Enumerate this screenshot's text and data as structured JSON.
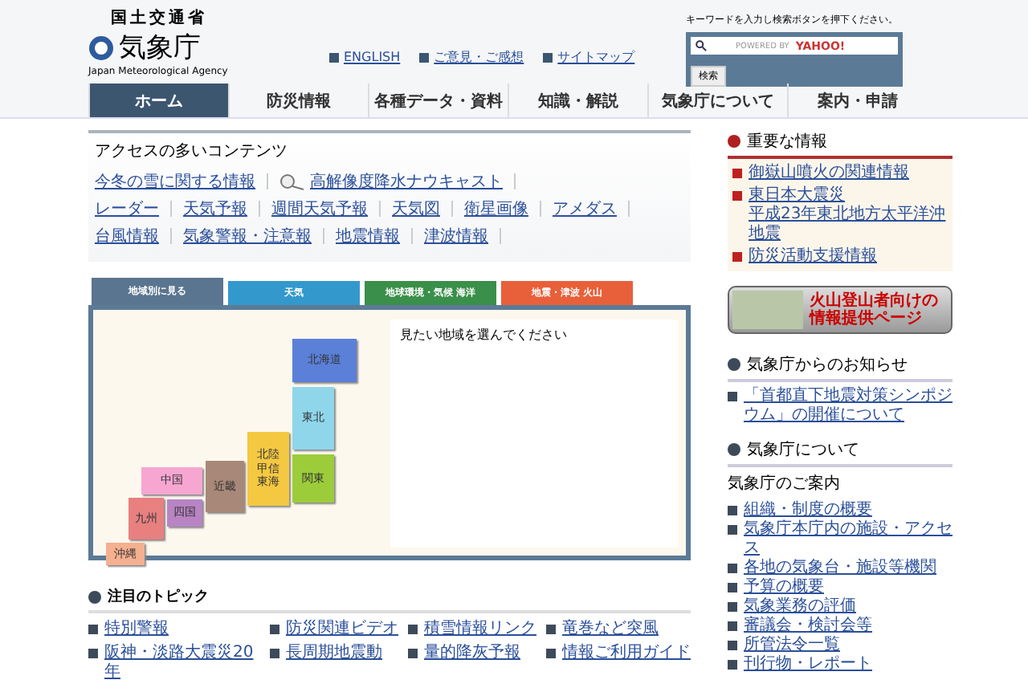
{
  "header": {
    "ministry": "国土交通省",
    "agency": "気象庁",
    "agency_en": "Japan Meteorological Agency",
    "links": [
      "ENGLISH",
      "ご意見・ご感想",
      "サイトマップ"
    ],
    "search": {
      "hint": "キーワードを入力し検索ボタンを押下ください。",
      "powered": "POWERED BY",
      "brand": "YAHOO!",
      "button": "検索"
    }
  },
  "nav": [
    {
      "label": "ホーム",
      "selected": true
    },
    {
      "label": "防災情報",
      "selected": false
    },
    {
      "label": "各種データ・資料",
      "selected": false
    },
    {
      "label": "知識・解説",
      "selected": false
    },
    {
      "label": "気象庁について",
      "selected": false
    },
    {
      "label": "案内・申請",
      "selected": false
    }
  ],
  "popular": {
    "title": "アクセスの多いコンテンツ",
    "rows": [
      {
        "links": [
          {
            "label": "今冬の雪に関する情報",
            "kind": "text"
          },
          {
            "label": "高解像度降水ナウキャスト",
            "kind": "icon"
          }
        ]
      },
      {
        "links": [
          {
            "label": "レーダー",
            "kind": "text"
          },
          {
            "label": "天気予報",
            "kind": "text"
          },
          {
            "label": "週間天気予報",
            "kind": "text"
          },
          {
            "label": "天気図",
            "kind": "text"
          },
          {
            "label": "衛星画像",
            "kind": "text"
          },
          {
            "label": "アメダス",
            "kind": "text"
          }
        ]
      },
      {
        "links": [
          {
            "label": "台風情報",
            "kind": "text"
          },
          {
            "label": "気象警報・注意報",
            "kind": "text"
          },
          {
            "label": "地震情報",
            "kind": "text"
          },
          {
            "label": "津波情報",
            "kind": "text"
          }
        ]
      }
    ]
  },
  "tabs": [
    {
      "label": "地域別に見る",
      "selected": true,
      "color": "#5a7590"
    },
    {
      "label": "天気",
      "selected": false,
      "color": "#3399cc"
    },
    {
      "label": "地球環境・気候 海洋",
      "selected": false,
      "color": "#3a8f4a"
    },
    {
      "label": "地震・津波 火山",
      "selected": false,
      "color": "#e8603a"
    }
  ],
  "regions": {
    "message": "見たい地域を選んでください",
    "areas": [
      {
        "lines": [
          "北海道"
        ],
        "color": "#5b80d8"
      },
      {
        "lines": [
          "東北"
        ],
        "color": "#8fd6ea"
      },
      {
        "lines": [
          "中国"
        ],
        "color": "#f7a6d2"
      },
      {
        "lines": [
          "近畿"
        ],
        "color": "#a88878"
      },
      {
        "lines": [
          "北陸",
          "甲信",
          "東海"
        ],
        "color": "#f5c842"
      },
      {
        "lines": [
          "関東"
        ],
        "color": "#9ccc3a"
      },
      {
        "lines": [
          "九州"
        ],
        "color": "#e88080"
      },
      {
        "lines": [
          "四国"
        ],
        "color": "#b884c4"
      },
      {
        "lines": [
          "沖縄"
        ],
        "color": "#f5b090"
      }
    ]
  },
  "topics": {
    "title": "注目のトピック",
    "items": [
      "特別警報",
      "防災関連ビデオ",
      "積雪情報リンク",
      "竜巻など突風",
      "阪神・淡路大震災20年",
      "長周期地震動",
      "量的降灰予報",
      "情報ご利用ガイド"
    ]
  },
  "sidebar": {
    "important": {
      "title": "重要な情報",
      "items": [
        {
          "lines": [
            "御嶽山噴火の関連情報"
          ]
        },
        {
          "lines": [
            "東日本大震災",
            "平成23年東北地方太平洋沖地震"
          ]
        },
        {
          "lines": [
            "防災活動支援情報"
          ]
        }
      ]
    },
    "banner": [
      "火山登山者向けの",
      "情報提供ページ"
    ],
    "notices": {
      "title": "気象庁からのお知らせ",
      "items": [
        "「首都直下地震対策シンポジウム」の開催について"
      ]
    },
    "about": {
      "title": "気象庁について",
      "subtitle": "気象庁のご案内",
      "items": [
        "組織・制度の概要",
        "気象庁本庁内の施設・アクセス",
        "各地の気象台・施設等機関",
        "予算の概要",
        "気象業務の評価",
        "審議会・検討会等",
        "所管法令一覧",
        "刊行物・レポート"
      ]
    }
  }
}
